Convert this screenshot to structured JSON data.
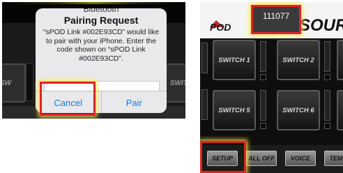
{
  "left_panel": {
    "alert": {
      "header": "Bluetooth",
      "title": "Pairing Request",
      "message": "“sPOD Link #002E93CD” would like to pair with your iPhone. Enter the code shown on “sPOD Link #002E93CD”.",
      "code_field_value": "",
      "cancel_label": "Cancel",
      "pair_label": "Pair"
    },
    "background": {
      "switch_left_label": "SW",
      "switch_right_label": "SWITC"
    }
  },
  "right_panel": {
    "logo": {
      "brand": "POD",
      "source_text": "SOURC"
    },
    "counter_value": "111077",
    "switches": [
      {
        "label": "SWITCH 1"
      },
      {
        "label": "SWITCH 2"
      },
      {
        "label": "SWITCH 5"
      },
      {
        "label": "SWITCH 6"
      }
    ],
    "bottom_buttons": [
      {
        "label": "SETUP"
      },
      {
        "label": "ALL OFF"
      },
      {
        "label": "VOICE"
      },
      {
        "label": "TEMP"
      }
    ]
  },
  "colors": {
    "highlight_red": "#e2222a",
    "glow_yellow": "#ffeb3c",
    "ios_link_blue": "#1a7be0"
  }
}
